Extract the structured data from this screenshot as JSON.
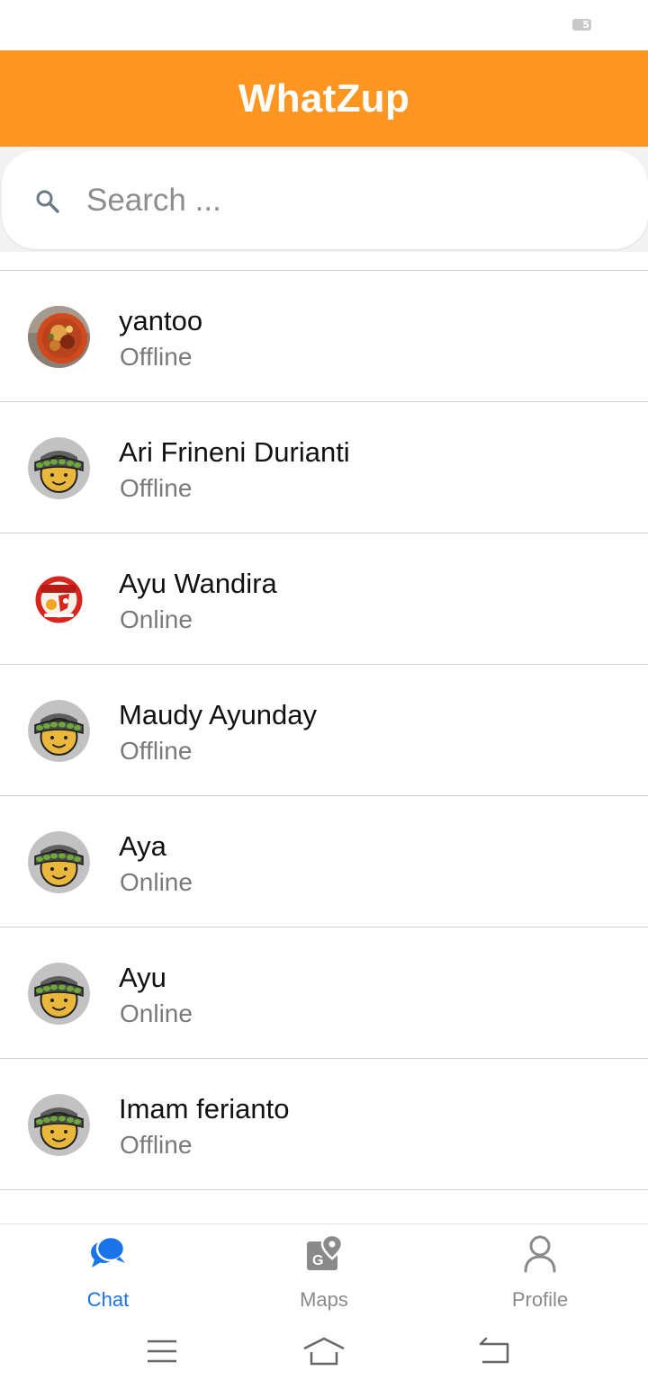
{
  "status_bar": {
    "battery_text": "5"
  },
  "app_bar": {
    "title": "WhatZup"
  },
  "search": {
    "placeholder": "Search ..."
  },
  "contacts": [
    {
      "name": "yantoo",
      "status": "Offline",
      "avatar": "food-photo"
    },
    {
      "name": "Ari Frineni Durianti",
      "status": "Offline",
      "avatar": "default-face"
    },
    {
      "name": "Ayu Wandira",
      "status": "Online",
      "avatar": "restaurant-logo"
    },
    {
      "name": "Maudy Ayunday",
      "status": "Offline",
      "avatar": "default-face"
    },
    {
      "name": "Aya",
      "status": "Online",
      "avatar": "default-face"
    },
    {
      "name": "Ayu",
      "status": "Online",
      "avatar": "default-face"
    },
    {
      "name": "Imam ferianto",
      "status": "Offline",
      "avatar": "default-face"
    }
  ],
  "bottom_nav": {
    "items": [
      {
        "label": "Chat",
        "icon": "chat-bubbles-icon",
        "active": true
      },
      {
        "label": "Maps",
        "icon": "maps-icon",
        "active": false
      },
      {
        "label": "Profile",
        "icon": "person-icon",
        "active": false
      }
    ],
    "active_color": "#1a73e8",
    "inactive_color": "#8a8a8a"
  },
  "colors": {
    "app_bar": "#ff9622",
    "accent": "#1a73e8"
  },
  "system_nav": {
    "icons": [
      "menu-icon",
      "home-icon",
      "back-icon"
    ]
  }
}
